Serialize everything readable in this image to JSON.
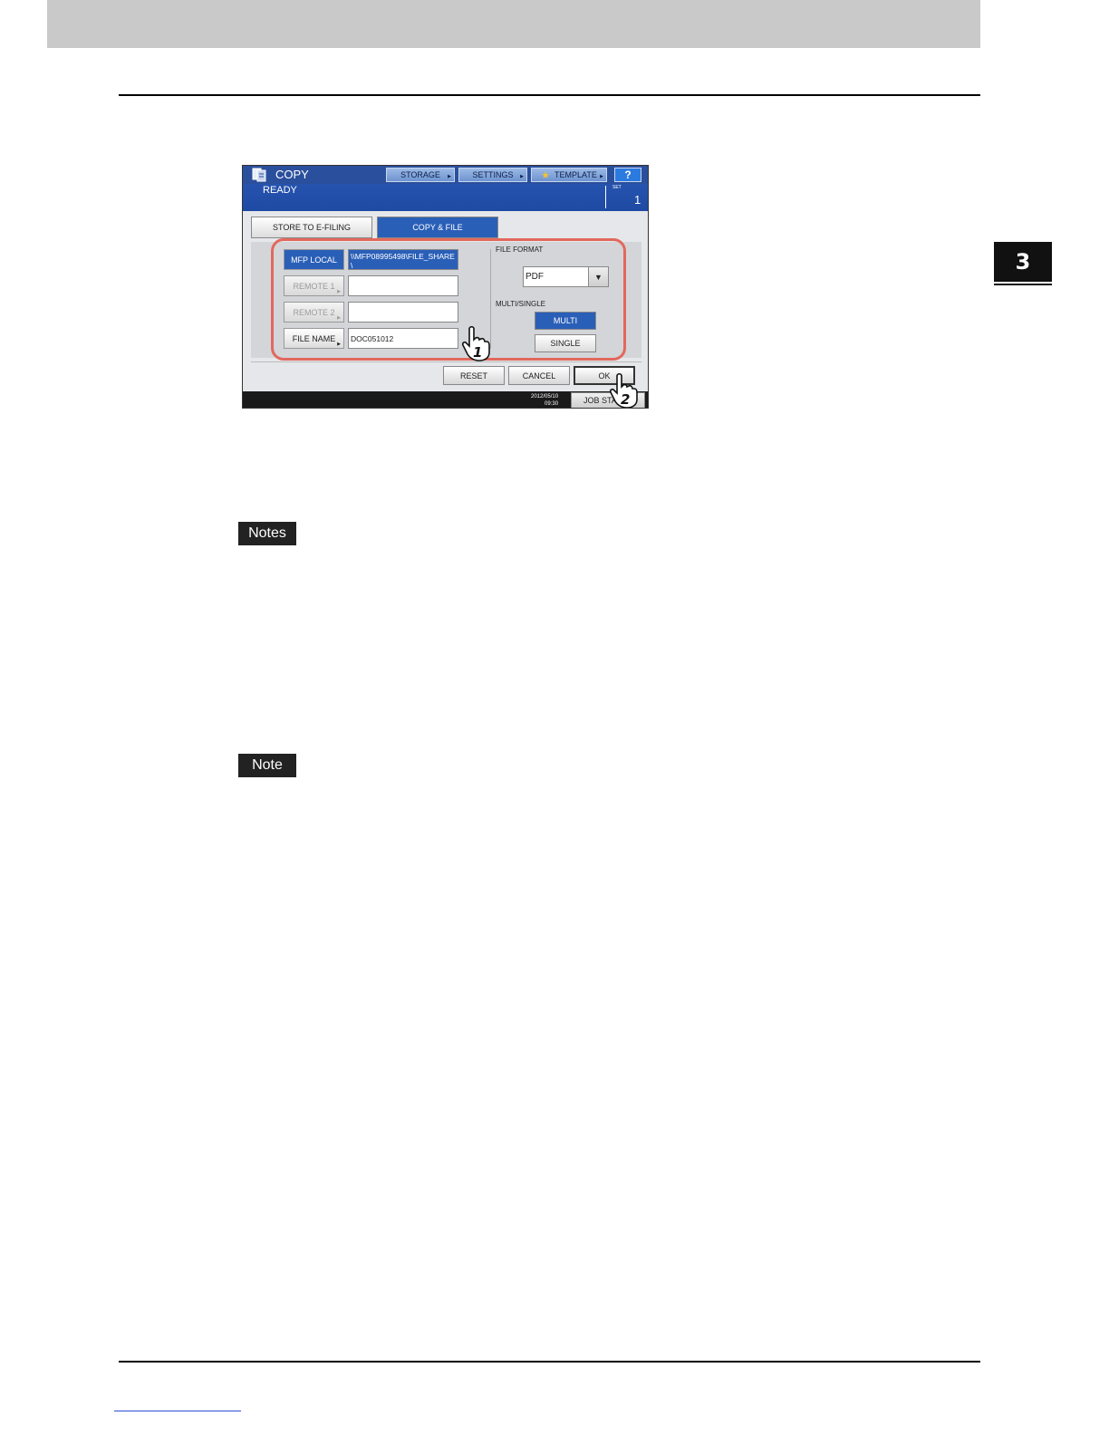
{
  "chapter": {
    "number": "3"
  },
  "labels": {
    "notes": "Notes",
    "note": "Note"
  },
  "screen": {
    "app_title": "COPY",
    "status": "READY",
    "set_label": "SET",
    "set_value": "1",
    "top_buttons": {
      "storage": "STORAGE",
      "settings": "SETTINGS",
      "template": "TEMPLATE",
      "help": "?"
    },
    "tabs": {
      "store": "STORE TO E-FILING",
      "copy_file": "COPY & FILE"
    },
    "destinations": {
      "mfp_local": "MFP LOCAL",
      "mfp_local_path": "\\\\MFP08995498\\FILE_SHARE\\",
      "remote1": "REMOTE 1",
      "remote1_value": "",
      "remote2": "REMOTE 2",
      "remote2_value": "",
      "file_name": "FILE NAME",
      "file_name_value": "DOC051012"
    },
    "file_format": {
      "label": "FILE FORMAT",
      "value": "PDF"
    },
    "multi_single": {
      "label": "MULTI/SINGLE",
      "multi": "MULTI",
      "single": "SINGLE"
    },
    "actions": {
      "reset": "RESET",
      "cancel": "CANCEL",
      "ok": "OK"
    },
    "date_line1": "2012/05/10",
    "date_line2": "09:30",
    "job_status": "JOB STATUS",
    "callouts": {
      "step1": "1",
      "step2": "2"
    }
  },
  "colors": {
    "accent": "#2a5fb8",
    "highlight": "#e2685c",
    "header_gray": "#c9c9c9"
  }
}
